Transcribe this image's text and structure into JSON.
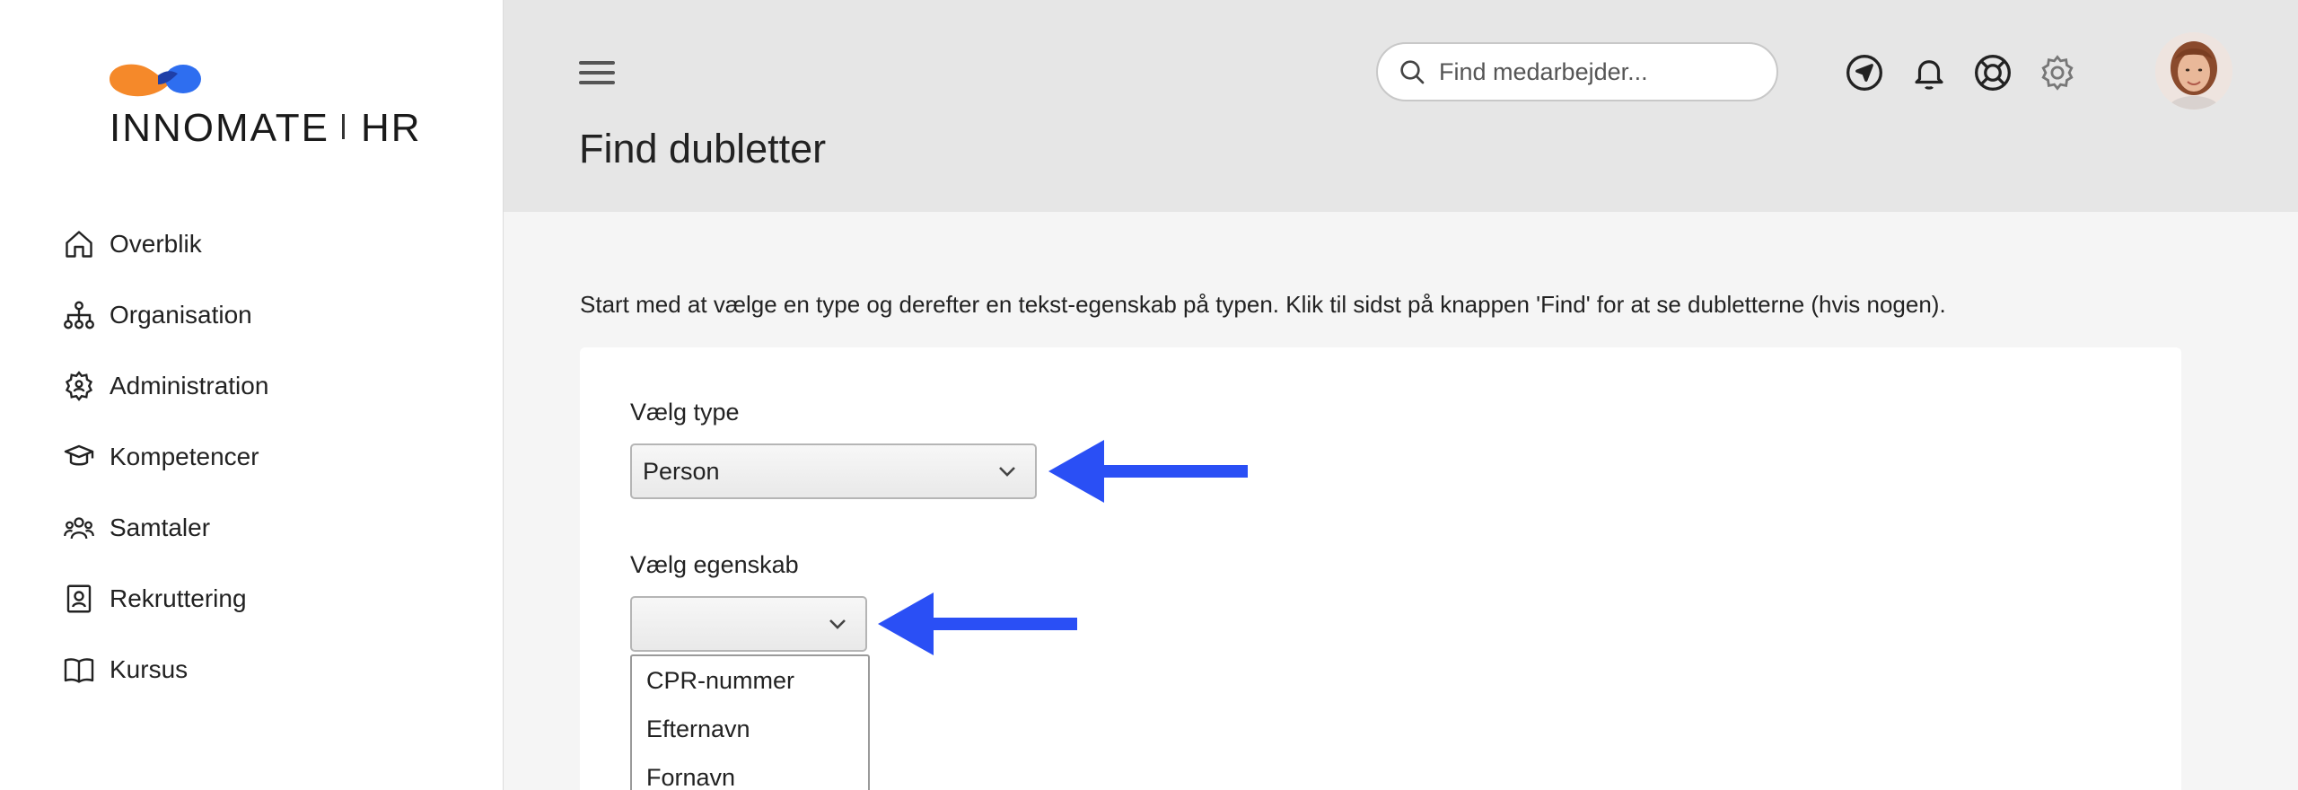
{
  "brand": {
    "name_part1": "INNOMATE",
    "name_part2": "HR",
    "colors": {
      "orange": "#f5892a",
      "blue": "#2e6ef0"
    }
  },
  "sidebar": {
    "items": [
      {
        "label": "Overblik",
        "icon": "home-icon"
      },
      {
        "label": "Organisation",
        "icon": "org-chart-icon"
      },
      {
        "label": "Administration",
        "icon": "gear-user-icon"
      },
      {
        "label": "Kompetencer",
        "icon": "graduation-cap-icon"
      },
      {
        "label": "Samtaler",
        "icon": "people-icon"
      },
      {
        "label": "Rekruttering",
        "icon": "id-badge-icon"
      },
      {
        "label": "Kursus",
        "icon": "book-icon"
      }
    ]
  },
  "header": {
    "search_placeholder": "Find medarbejder...",
    "icons": [
      "navigate-icon",
      "bell-icon",
      "help-lifebuoy-icon",
      "settings-icon"
    ],
    "page_title": "Find dubletter"
  },
  "content": {
    "intro": "Start med at vælge en type og derefter en tekst-egenskab på typen. Klik til sidst på knappen 'Find' for at se dubletterne (hvis nogen).",
    "type_label": "Vælg type",
    "type_value": "Person",
    "property_label": "Vælg egenskab",
    "property_value": "",
    "property_options": [
      "CPR-nummer",
      "Efternavn",
      "Fornavn"
    ]
  },
  "annotation_color": "#2a4ff5"
}
